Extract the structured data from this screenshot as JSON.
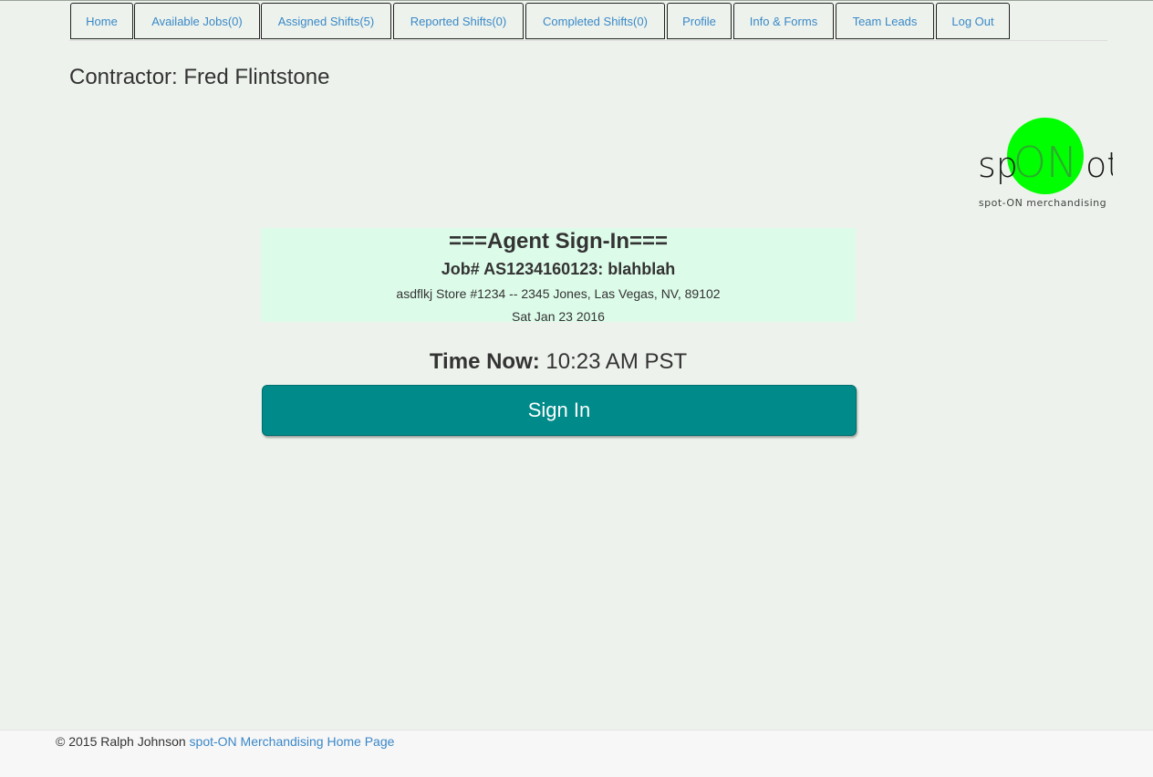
{
  "nav": {
    "tabs": [
      {
        "label": "Home"
      },
      {
        "label": "Available Jobs(0)"
      },
      {
        "label": "Assigned Shifts(5)"
      },
      {
        "label": "Reported Shifts(0)"
      },
      {
        "label": "Completed Shifts(0)"
      },
      {
        "label": "Profile"
      },
      {
        "label": "Info & Forms"
      },
      {
        "label": "Team Leads"
      },
      {
        "label": "Log Out"
      }
    ]
  },
  "page": {
    "contractor_label": "Contractor: Fred Flintstone"
  },
  "logo": {
    "left_text": "sp",
    "circle_text": "ON",
    "right_text": "ot",
    "tagline": "spot-ON merchandising",
    "circle_color": "#00ff00"
  },
  "signin": {
    "title": "===Agent Sign-In===",
    "job": "Job# AS1234160123: blahblah",
    "address": "asdflkj Store #1234 -- 2345 Jones, Las Vegas, NV, 89102",
    "date": "Sat Jan 23 2016",
    "time_label": "Time Now:",
    "time_value": "10:23 AM PST",
    "button_label": "Sign In"
  },
  "footer": {
    "copyright": "© 2015 Ralph Johnson",
    "link_text": "spot-ON Merchandising Home Page"
  },
  "colors": {
    "background": "#edf3ec",
    "link": "#3a87c8",
    "signin_box": "#ddfbe9",
    "button": "#008a89"
  }
}
